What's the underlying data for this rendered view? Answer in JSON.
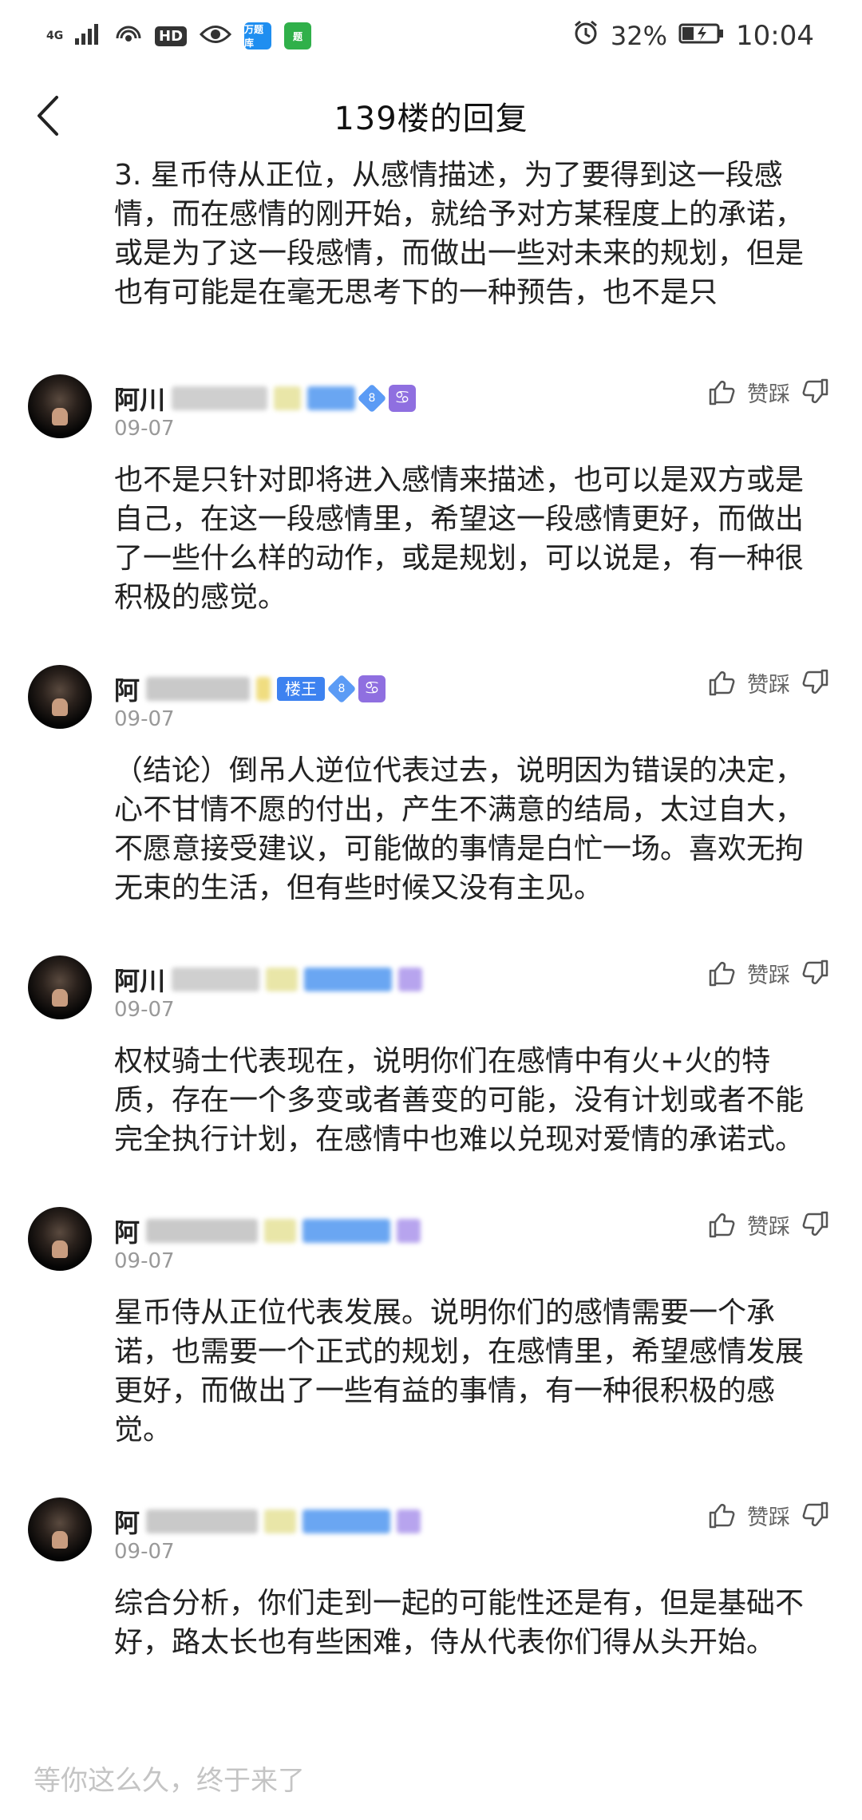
{
  "status_bar": {
    "network": "4G",
    "hd": "HD",
    "app_badge_1": "万题库",
    "app_badge_2": "题",
    "battery_percent": "32%",
    "time": "10:04",
    "colors": {
      "app_blue": "#1f8ef0",
      "app_green": "#30b04a"
    }
  },
  "header": {
    "title": "139楼的回复"
  },
  "top_text": "3. 星币侍从正位，从感情描述，为了要得到这一段感情，而在感情的刚开始，就给予对方某程度上的承诺，或是为了这一段感情，而做出一些对未来的规划，但是也有可能是在毫无思考下的一种预告，也不是只",
  "replies": [
    {
      "username": "阿川",
      "level": "8",
      "zodiac": "♋",
      "date": "09-07",
      "actions_label": "赞踩",
      "body": "也不是只针对即将进入感情来描述，也可以是双方或是自己，在这一段感情里，希望这一段感情更好，而做出了一些什么样的动作，或是规划，可以说是，有一种很积极的感觉。"
    },
    {
      "username": "阿",
      "rank": "楼王",
      "level": "8",
      "zodiac": "♋",
      "date": "09-07",
      "actions_label": "赞踩",
      "body": "（结论）倒吊人逆位代表过去，说明因为错误的决定，心不甘情不愿的付出，产生不满意的结局，太过自大，不愿意接受建议，可能做的事情是白忙一场。喜欢无拘无束的生活，但有些时候又没有主见。"
    },
    {
      "username": "阿川",
      "date": "09-07",
      "actions_label": "赞踩",
      "body": "权杖骑士代表现在，说明你们在感情中有火+火的特质，存在一个多变或者善变的可能，没有计划或者不能完全执行计划，在感情中也难以兑现对爱情的承诺式。"
    },
    {
      "username": "阿",
      "date": "09-07",
      "actions_label": "赞踩",
      "body": "星币侍从正位代表发展。说明你们的感情需要一个承诺，也需要一个正式的规划，在感情里，希望感情发展更好，而做出了一些有益的事情，有一种很积极的感觉。"
    },
    {
      "username": "阿",
      "date": "09-07",
      "actions_label": "赞踩",
      "body": "综合分析，你们走到一起的可能性还是有，但是基础不好，路太长也有些困难，侍从代表你们得从头开始。"
    }
  ],
  "bottom": {
    "placeholder": "等你这么久，终于来了"
  }
}
